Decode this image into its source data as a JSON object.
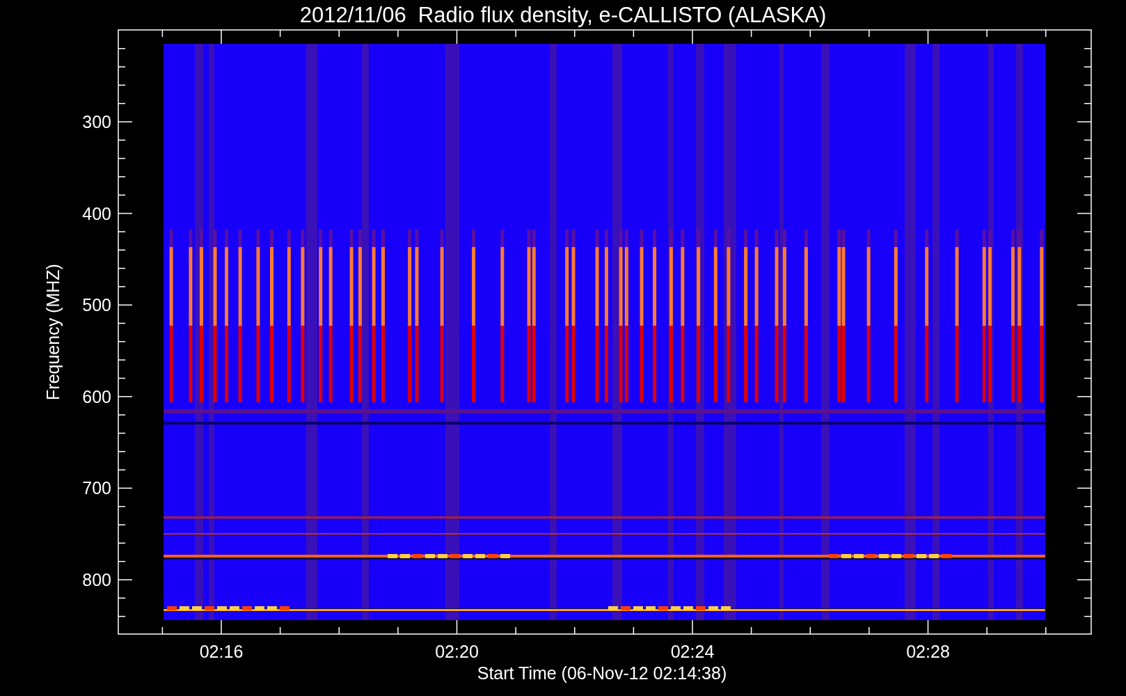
{
  "title": "2012/11/06  Radio flux density, e-CALLISTO (ALASKA)",
  "y_axis": {
    "label": "Frequency (MHZ)",
    "ticks": [
      "300",
      "400",
      "500",
      "600",
      "700",
      "800"
    ]
  },
  "x_axis": {
    "label": "Start Time (06-Nov-12 02:14:38)",
    "ticks": [
      "02:16",
      "02:20",
      "02:24",
      "02:28"
    ]
  }
}
